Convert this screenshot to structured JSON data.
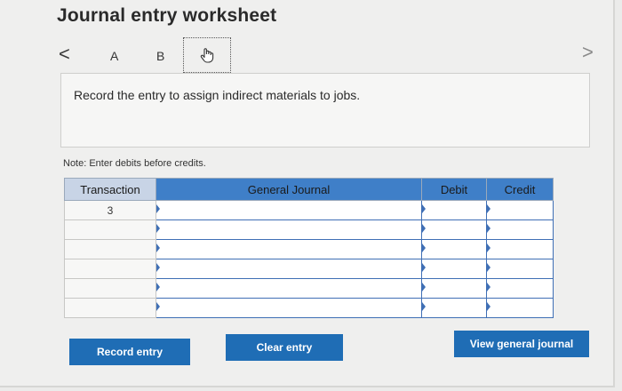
{
  "worksheet": {
    "title": "Journal entry worksheet"
  },
  "nav": {
    "prev_icon": "chevron-left",
    "next_icon": "chevron-right",
    "prev_glyph": "<",
    "next_glyph": ">"
  },
  "tabs": [
    {
      "label": "A"
    },
    {
      "label": "B"
    },
    {
      "label": "",
      "icon": "hand-pointer-icon",
      "active": true
    }
  ],
  "instruction": {
    "text": "Record the entry to assign indirect materials to jobs."
  },
  "note": {
    "text": "Note: Enter debits before credits."
  },
  "journal": {
    "headers": [
      "Transaction",
      "General Journal",
      "Debit",
      "Credit"
    ],
    "rows": [
      {
        "transaction": "3",
        "account": "",
        "debit": "",
        "credit": ""
      },
      {
        "transaction": "",
        "account": "",
        "debit": "",
        "credit": ""
      },
      {
        "transaction": "",
        "account": "",
        "debit": "",
        "credit": ""
      },
      {
        "transaction": "",
        "account": "",
        "debit": "",
        "credit": ""
      },
      {
        "transaction": "",
        "account": "",
        "debit": "",
        "credit": ""
      },
      {
        "transaction": "",
        "account": "",
        "debit": "",
        "credit": ""
      }
    ]
  },
  "buttons": {
    "record": "Record entry",
    "clear": "Clear entry",
    "view": "View general journal"
  },
  "colors": {
    "header_blue": "#3f7fc8",
    "button_blue": "#1f6db5"
  }
}
